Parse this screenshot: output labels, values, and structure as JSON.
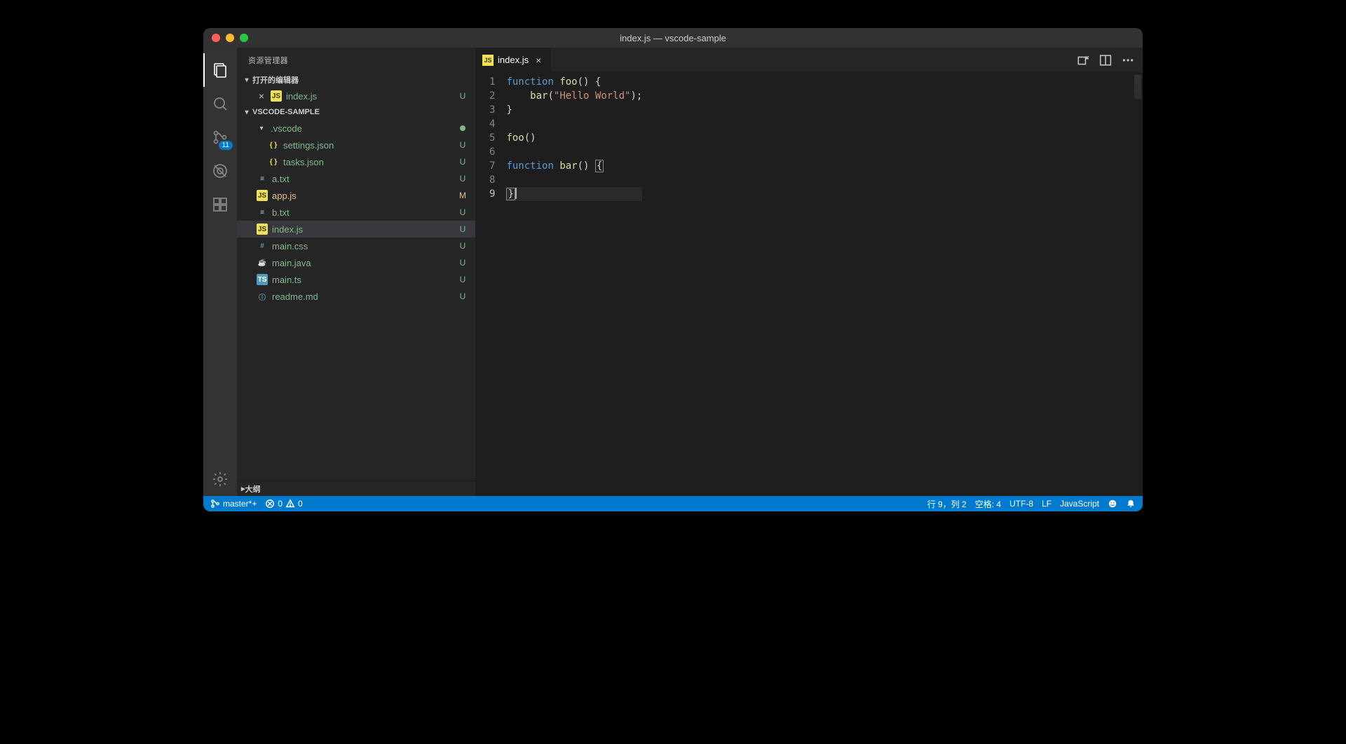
{
  "window": {
    "title": "index.js — vscode-sample"
  },
  "activitybar": {
    "scm_badge": "11"
  },
  "sidebar": {
    "title": "资源管理器",
    "sections": {
      "open_editors": "打开的编辑器",
      "project": "VSCODE-SAMPLE",
      "outline": "大纲"
    },
    "open_editor_item": {
      "name": "index.js",
      "status": "U"
    },
    "tree": [
      {
        "name": ".vscode",
        "type": "folder",
        "status_dot": true
      },
      {
        "name": "settings.json",
        "type": "json",
        "status": "U",
        "indent": 2
      },
      {
        "name": "tasks.json",
        "type": "json",
        "status": "U",
        "indent": 2
      },
      {
        "name": "a.txt",
        "type": "txt",
        "status": "U"
      },
      {
        "name": "app.js",
        "type": "js",
        "status": "M"
      },
      {
        "name": "b.txt",
        "type": "txt",
        "status": "U"
      },
      {
        "name": "index.js",
        "type": "js",
        "status": "U",
        "selected": true
      },
      {
        "name": "main.css",
        "type": "css",
        "status": "U"
      },
      {
        "name": "main.java",
        "type": "java",
        "status": "U"
      },
      {
        "name": "main.ts",
        "type": "ts",
        "status": "U"
      },
      {
        "name": "readme.md",
        "type": "md",
        "status": "U"
      }
    ]
  },
  "editor": {
    "tab": {
      "label": "index.js"
    },
    "code": {
      "lines": [
        {
          "n": 1,
          "t": [
            [
              "kw",
              "function"
            ],
            [
              "punc",
              " "
            ],
            [
              "fn",
              "foo"
            ],
            [
              "punc",
              "() {"
            ]
          ]
        },
        {
          "n": 2,
          "t": [
            [
              "punc",
              "    "
            ],
            [
              "fn",
              "bar"
            ],
            [
              "punc",
              "("
            ],
            [
              "str",
              "\"Hello World\""
            ],
            [
              "punc",
              ");"
            ]
          ]
        },
        {
          "n": 3,
          "t": [
            [
              "punc",
              "}"
            ]
          ]
        },
        {
          "n": 4,
          "t": []
        },
        {
          "n": 5,
          "t": [
            [
              "fn",
              "foo"
            ],
            [
              "punc",
              "()"
            ]
          ]
        },
        {
          "n": 6,
          "t": []
        },
        {
          "n": 7,
          "t": [
            [
              "kw",
              "function"
            ],
            [
              "punc",
              " "
            ],
            [
              "fn",
              "bar"
            ],
            [
              "punc",
              "() "
            ],
            [
              "br",
              "{"
            ]
          ]
        },
        {
          "n": 8,
          "t": []
        },
        {
          "n": 9,
          "t": [
            [
              "br",
              "}"
            ]
          ],
          "active": true
        }
      ]
    }
  },
  "status": {
    "branch": "master*+",
    "errors": "0",
    "warnings": "0",
    "cursor": "行 9，列 2",
    "spaces": "空格: 4",
    "encoding": "UTF-8",
    "eol": "LF",
    "language": "JavaScript"
  }
}
